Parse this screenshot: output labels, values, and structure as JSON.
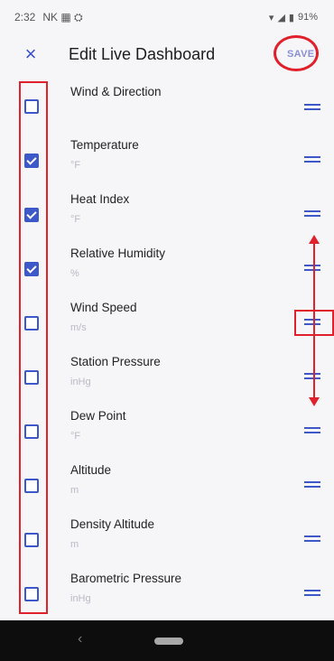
{
  "status": {
    "time": "2:32",
    "icons_left": "NK ▦ ⛭",
    "battery": "91%"
  },
  "header": {
    "title": "Edit Live Dashboard",
    "save_label": "SAVE",
    "close_glyph": "×"
  },
  "items": [
    {
      "label": "Wind & Direction",
      "unit": "",
      "checked": false
    },
    {
      "label": "Temperature",
      "unit": "°F",
      "checked": true
    },
    {
      "label": "Heat Index",
      "unit": "°F",
      "checked": true
    },
    {
      "label": "Relative Humidity",
      "unit": "%",
      "checked": true
    },
    {
      "label": "Wind Speed",
      "unit": "m/s",
      "checked": false
    },
    {
      "label": "Station Pressure",
      "unit": "inHg",
      "checked": false
    },
    {
      "label": "Dew Point",
      "unit": "°F",
      "checked": false
    },
    {
      "label": "Altitude",
      "unit": "m",
      "checked": false
    },
    {
      "label": "Density Altitude",
      "unit": "m",
      "checked": false
    },
    {
      "label": "Barometric Pressure",
      "unit": "inHg",
      "checked": false
    }
  ],
  "nav": {
    "back_glyph": "‹"
  },
  "colors": {
    "accent": "#3d58c9",
    "annotation": "#e0212c"
  }
}
